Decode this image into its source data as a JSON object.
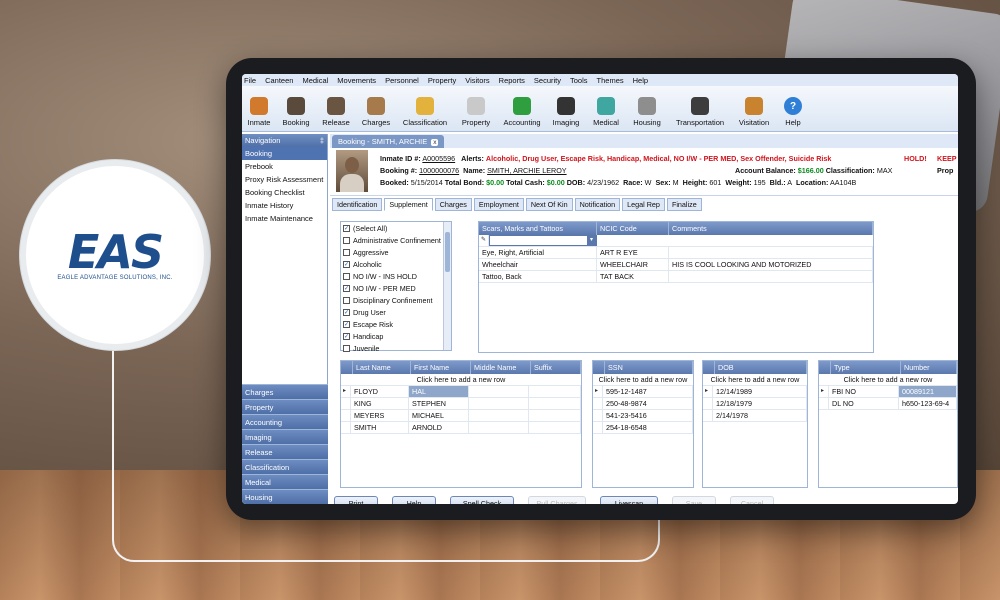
{
  "logo": {
    "mark": "EAS",
    "company": "EAGLE ADVANTAGE SOLUTIONS, INC."
  },
  "menu": [
    "File",
    "Canteen",
    "Medical",
    "Movements",
    "Personnel",
    "Property",
    "Visitors",
    "Reports",
    "Security",
    "Tools",
    "Themes",
    "Help"
  ],
  "toolbar": [
    {
      "label": "Inmate",
      "icon": "inmate-icon",
      "color": "#d17a2e"
    },
    {
      "label": "Booking",
      "icon": "booking-icon",
      "color": "#5a4a3c"
    },
    {
      "label": "Release",
      "icon": "release-icon",
      "color": "#6a5442"
    },
    {
      "label": "Charges",
      "icon": "charges-icon",
      "color": "#a67a4a"
    },
    {
      "label": "Classification",
      "icon": "classification-icon",
      "color": "#e3b23c"
    },
    {
      "label": "Property",
      "icon": "property-icon",
      "color": "#c9c9c9"
    },
    {
      "label": "Accounting",
      "icon": "accounting-icon",
      "color": "#2e9e3e"
    },
    {
      "label": "Imaging",
      "icon": "imaging-icon",
      "color": "#333333"
    },
    {
      "label": "Medical",
      "icon": "medical-icon",
      "color": "#3fa6a0"
    },
    {
      "label": "Housing",
      "icon": "housing-icon",
      "color": "#8e8e8e"
    },
    {
      "label": "Transportation",
      "icon": "transportation-icon",
      "color": "#3d3d3d"
    },
    {
      "label": "Visitation",
      "icon": "visitation-icon",
      "color": "#c9832f"
    },
    {
      "label": "Help",
      "icon": "help-icon",
      "color": "#2f7fd6"
    }
  ],
  "nav": {
    "header": "Navigation",
    "pin": "‡",
    "items": [
      "Booking",
      "Prebook",
      "Proxy Risk Assessment",
      "Booking Checklist",
      "Inmate History",
      "Inmate Maintenance"
    ],
    "sections": [
      "Charges",
      "Property",
      "Accounting",
      "Imaging",
      "Release",
      "Classification",
      "Medical",
      "Housing"
    ]
  },
  "doc_tab": {
    "label": "Booking - SMITH, ARCHIE",
    "close": "x"
  },
  "inmate": {
    "id_label": "Inmate ID #:",
    "id": "A0005596",
    "alerts_label": "Alerts:",
    "alerts": "Alcoholic, Drug User, Escape Risk, Handicap, Medical, NO I/W - PER MED, Sex Offender, Suicide Risk",
    "hold": "HOLD!",
    "keep": "KEEP",
    "booking_label": "Booking #:",
    "booking": "1000000076",
    "name_label": "Name:",
    "name": "SMITH, ARCHIE LEROY",
    "balance_label": "Account Balance:",
    "balance": "$166.00",
    "class_label": "Classification:",
    "class": "MAX",
    "prop": "Prop",
    "booked_label": "Booked:",
    "booked": "5/15/2014",
    "bond_label": "Total Bond:",
    "bond": "$0.00",
    "cash_label": "Total Cash:",
    "cash": "$0.00",
    "dob_label": "DOB:",
    "dob": "4/23/1962",
    "race_label": "Race:",
    "race": "W",
    "sex_label": "Sex:",
    "sex": "M",
    "height_label": "Height:",
    "height": "601",
    "weight_label": "Weight:",
    "weight": "195",
    "bld_label": "Bld.:",
    "bld": "A",
    "location_label": "Location:",
    "location": "AA104B"
  },
  "subtabs": [
    "Identification",
    "Supplement",
    "Charges",
    "Employment",
    "Next Of Kin",
    "Notification",
    "Legal Rep",
    "Finalize"
  ],
  "checklist": [
    {
      "label": "(Select All)",
      "checked": true
    },
    {
      "label": "Administrative Confinement",
      "checked": false
    },
    {
      "label": "Aggressive",
      "checked": false
    },
    {
      "label": "Alcoholic",
      "checked": true
    },
    {
      "label": "NO I/W - INS HOLD",
      "checked": false
    },
    {
      "label": "NO I/W - PER MED",
      "checked": true
    },
    {
      "label": "Disciplinary Confinement",
      "checked": false
    },
    {
      "label": "Drug User",
      "checked": true
    },
    {
      "label": "Escape Risk",
      "checked": true
    },
    {
      "label": "Handicap",
      "checked": true
    },
    {
      "label": "Juvenile",
      "checked": false
    }
  ],
  "scars": {
    "headers": [
      "Scars, Marks and Tattoos",
      "NCIC Code",
      "Comments"
    ],
    "rows": [
      [
        "Eye, Right, Artificial",
        "ART R EYE",
        ""
      ],
      [
        "Wheelchair",
        "WHEELCHAIR",
        "HIS IS COOL LOOKING AND MOTORIZED"
      ],
      [
        "Tattoo, Back",
        "TAT BACK",
        ""
      ]
    ]
  },
  "add_row": "Click here to add a new row",
  "names": {
    "headers": [
      "Last Name",
      "First Name",
      "Middle Name",
      "Suffix"
    ],
    "rows": [
      [
        "FLOYD",
        "HAL",
        "",
        ""
      ],
      [
        "KING",
        "STEPHEN",
        "",
        ""
      ],
      [
        "MEYERS",
        "MICHAEL",
        "",
        ""
      ],
      [
        "SMITH",
        "ARNOLD",
        "",
        ""
      ]
    ]
  },
  "ssn": {
    "headers": [
      "SSN"
    ],
    "rows": [
      "595-12-1487",
      "250-48-9874",
      "541-23-5416",
      "254-18-6548"
    ]
  },
  "dob": {
    "headers": [
      "DOB"
    ],
    "rows": [
      "12/14/1989",
      "12/18/1979",
      "2/14/1978"
    ]
  },
  "ids": {
    "headers": [
      "Type",
      "Number"
    ],
    "rows": [
      [
        "FBI NO",
        "00089121"
      ],
      [
        "DL NO",
        "h650-123-69-4"
      ]
    ]
  },
  "buttons": [
    {
      "label": "Print",
      "enabled": true
    },
    {
      "label": "Help",
      "enabled": true
    },
    {
      "label": "Spell Check",
      "enabled": true
    },
    {
      "label": "Pull Charges",
      "enabled": false
    },
    {
      "label": "Livescan",
      "enabled": true
    },
    {
      "label": "Save",
      "enabled": false
    },
    {
      "label": "Cancel",
      "enabled": false
    }
  ]
}
